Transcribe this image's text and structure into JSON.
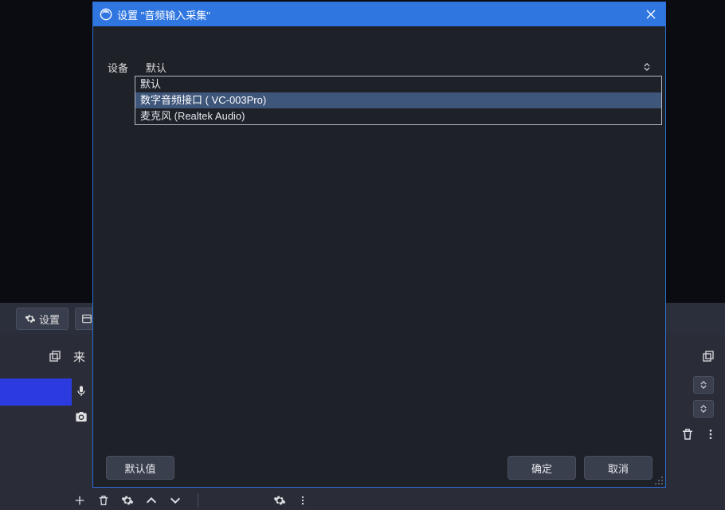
{
  "dialog": {
    "title": "设置 \"音频输入采集\"",
    "device_label": "设备",
    "device_selected": "默认",
    "dropdown_options": {
      "opt0": "默认",
      "opt1": "数字音频接口 ( VC-003Pro)",
      "opt2": "麦克风 (Realtek Audio)"
    },
    "buttons": {
      "defaults": "默认值",
      "ok": "确定",
      "cancel": "取消"
    }
  },
  "background": {
    "settings_btn_label": "设置",
    "sources_header": "来"
  },
  "icons": {
    "close": "close-icon",
    "obs": "obs-icon",
    "gear": "gear-icon",
    "dock": "dock-panel-icon",
    "mic": "microphone-icon",
    "camera": "camera-icon",
    "plus": "plus-icon",
    "trash": "trash-icon",
    "up": "chevron-up-icon",
    "down": "chevron-down-icon",
    "more": "more-vertical-icon"
  }
}
